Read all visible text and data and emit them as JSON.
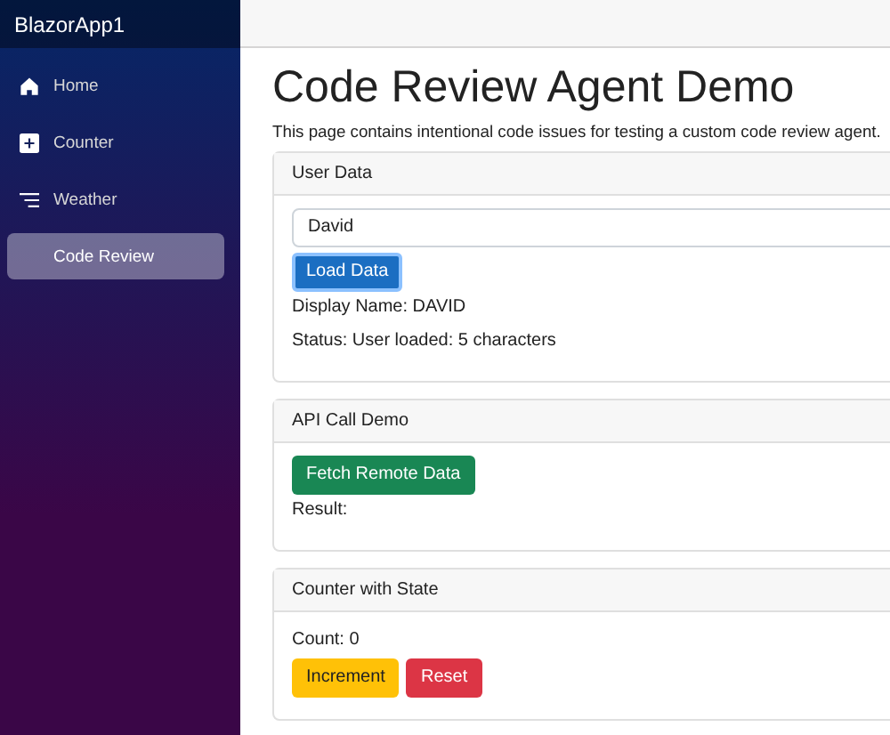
{
  "sidebar": {
    "brand": "BlazorApp1",
    "items": [
      {
        "label": "Home",
        "selected": false
      },
      {
        "label": "Counter",
        "selected": false
      },
      {
        "label": "Weather",
        "selected": false
      },
      {
        "label": "Code Review",
        "selected": true
      }
    ]
  },
  "page": {
    "title": "Code Review Agent Demo",
    "description": "This page contains intentional code issues for testing a custom code review agent."
  },
  "cards": [
    {
      "title": "User Data",
      "body": [
        {
          "kind": "input",
          "value": "David"
        },
        {
          "kind": "buttons",
          "buttons": [
            {
              "label": "Load Data",
              "color": "#1b6ec2",
              "focused": true
            }
          ]
        },
        {
          "kind": "text",
          "text": "Display Name: DAVID"
        },
        {
          "kind": "text",
          "text": "Status: User loaded: 5 characters"
        }
      ]
    },
    {
      "title": "API Call Demo",
      "body": [
        {
          "kind": "buttons",
          "buttons": [
            {
              "label": "Fetch Remote Data",
              "color": "#198754",
              "focused": false
            }
          ]
        },
        {
          "kind": "text",
          "text": "Result:"
        }
      ]
    },
    {
      "title": "Counter with State",
      "body": [
        {
          "kind": "text",
          "text": "Count: 0"
        },
        {
          "kind": "buttons",
          "buttons": [
            {
              "label": "Increment",
              "color": "#ffc107",
              "focused": false
            },
            {
              "label": "Reset",
              "color": "#dc3545",
              "focused": false
            }
          ]
        }
      ]
    }
  ]
}
